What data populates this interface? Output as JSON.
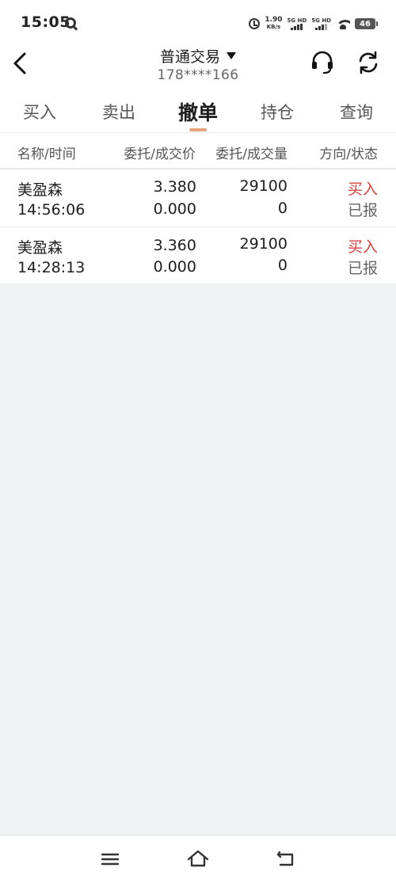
{
  "status_bar": {
    "time": "15:05",
    "net_speed": "1.90",
    "net_unit": "KB/s",
    "sim1": "5G HD",
    "sim2": "5G HD",
    "battery": "46"
  },
  "header": {
    "title": "普通交易",
    "account": "178****166"
  },
  "tabs": [
    {
      "label": "买入",
      "active": false
    },
    {
      "label": "卖出",
      "active": false
    },
    {
      "label": "撤单",
      "active": true
    },
    {
      "label": "持仓",
      "active": false
    },
    {
      "label": "查询",
      "active": false
    }
  ],
  "columns": {
    "name_time": "名称/时间",
    "price": "委托/成交价",
    "qty": "委托/成交量",
    "dir_status": "方向/状态"
  },
  "orders": [
    {
      "name": "美盈森",
      "time": "14:56:06",
      "order_price": "3.380",
      "deal_price": "0.000",
      "order_qty": "29100",
      "deal_qty": "0",
      "direction": "买入",
      "status": "已报"
    },
    {
      "name": "美盈森",
      "time": "14:28:13",
      "order_price": "3.360",
      "deal_price": "0.000",
      "order_qty": "29100",
      "deal_qty": "0",
      "direction": "买入",
      "status": "已报"
    }
  ],
  "colors": {
    "accent_buy": "#d9413b",
    "tab_indicator": "#e5a47d",
    "background": "#f1f2f4"
  },
  "icons": {
    "back": "chevron-left-icon",
    "service": "headset-icon",
    "refresh": "refresh-icon",
    "menu": "menu-icon",
    "home": "home-icon",
    "back_nav": "back-nav-icon"
  }
}
